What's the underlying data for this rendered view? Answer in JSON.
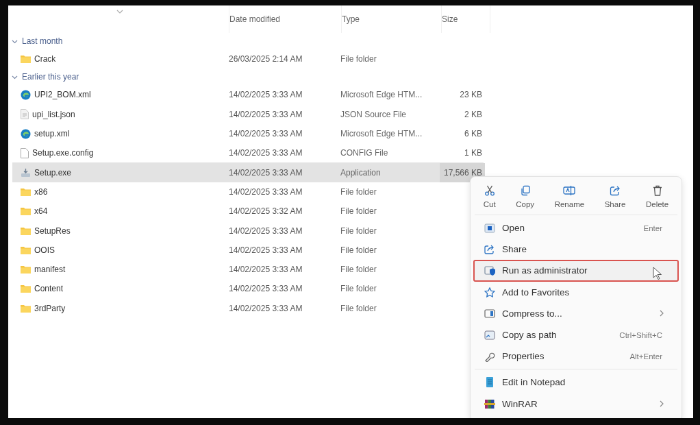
{
  "columns": [
    {
      "label": "Date modified"
    },
    {
      "label": "Type"
    },
    {
      "label": "Size"
    }
  ],
  "groups": [
    {
      "label": "Last month",
      "expanded": true,
      "files": [
        {
          "name": "Crack",
          "kind": "folder",
          "date": "26/03/2025 2:14 AM",
          "type": "File folder",
          "selected": false
        }
      ]
    },
    {
      "label": "Earlier this year",
      "expanded": true,
      "files": [
        {
          "name": "UPI2_BOM.xml",
          "kind": "edge",
          "date": "14/02/2025 3:33 AM",
          "type": "Microsoft Edge HTM...",
          "size": "23 KB",
          "selected": false
        },
        {
          "name": "upi_list.json",
          "kind": "json",
          "date": "14/02/2025 3:33 AM",
          "type": "JSON Source File",
          "size": "2 KB",
          "selected": false
        },
        {
          "name": "setup.xml",
          "kind": "edge",
          "date": "14/02/2025 3:33 AM",
          "type": "Microsoft Edge HTM...",
          "size": "6 KB",
          "selected": false
        },
        {
          "name": "Setup.exe.config",
          "kind": "config",
          "date": "14/02/2025 3:33 AM",
          "type": "CONFIG File",
          "size": "1 KB",
          "selected": false
        },
        {
          "name": "Setup.exe",
          "kind": "exe",
          "date": "14/02/2025 3:33 AM",
          "type": "Application",
          "size": "17,566 KB",
          "selected": true
        },
        {
          "name": "x86",
          "kind": "folder",
          "date": "14/02/2025 3:33 AM",
          "type": "File folder",
          "selected": false
        },
        {
          "name": "x64",
          "kind": "folder",
          "date": "14/02/2025 3:32 AM",
          "type": "File folder",
          "selected": false
        },
        {
          "name": "SetupRes",
          "kind": "folder",
          "date": "14/02/2025 3:33 AM",
          "type": "File folder",
          "selected": false
        },
        {
          "name": "OOIS",
          "kind": "folder",
          "date": "14/02/2025 3:33 AM",
          "type": "File folder",
          "selected": false
        },
        {
          "name": "manifest",
          "kind": "folder",
          "date": "14/02/2025 3:33 AM",
          "type": "File folder",
          "selected": false
        },
        {
          "name": "Content",
          "kind": "folder",
          "date": "14/02/2025 3:33 AM",
          "type": "File folder",
          "selected": false
        },
        {
          "name": "3rdParty",
          "kind": "folder",
          "date": "14/02/2025 3:33 AM",
          "type": "File folder",
          "selected": false
        }
      ]
    }
  ],
  "context_menu": {
    "actions": [
      {
        "label": "Cut"
      },
      {
        "label": "Copy"
      },
      {
        "label": "Rename"
      },
      {
        "label": "Share"
      },
      {
        "label": "Delete"
      }
    ],
    "sections": [
      [
        {
          "label": "Open",
          "shortcut": "Enter",
          "highlighted": false,
          "submenu": false
        },
        {
          "label": "Share",
          "highlighted": false,
          "submenu": false
        },
        {
          "label": "Run as administrator",
          "highlighted": true,
          "submenu": false
        },
        {
          "label": "Add to Favorites",
          "highlighted": false,
          "submenu": false
        },
        {
          "label": "Compress to...",
          "highlighted": false,
          "submenu": true
        },
        {
          "label": "Copy as path",
          "shortcut": "Ctrl+Shift+C",
          "highlighted": false,
          "submenu": false
        },
        {
          "label": "Properties",
          "shortcut": "Alt+Enter",
          "highlighted": false,
          "submenu": false
        }
      ],
      [
        {
          "label": "Edit in Notepad",
          "highlighted": false,
          "submenu": false
        },
        {
          "label": "WinRAR",
          "highlighted": false,
          "submenu": true
        }
      ]
    ]
  }
}
